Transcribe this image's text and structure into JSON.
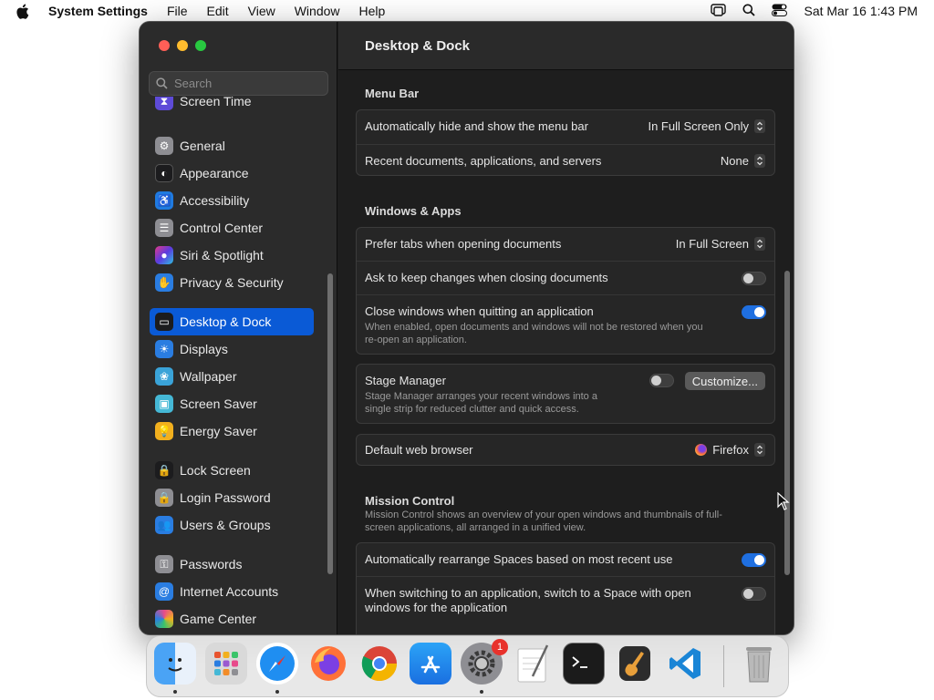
{
  "menubar": {
    "app_name": "System Settings",
    "menus": [
      "File",
      "Edit",
      "View",
      "Window",
      "Help"
    ],
    "datetime": "Sat Mar 16  1:43 PM"
  },
  "window": {
    "title": "Desktop & Dock"
  },
  "sidebar": {
    "search_placeholder": "Search",
    "items": [
      {
        "label": "Screen Time",
        "icon": "hourglass-icon",
        "color": "#5e4bd8"
      },
      {
        "label": "General",
        "icon": "gear-icon",
        "color": "#8e8e93"
      },
      {
        "label": "Appearance",
        "icon": "appearance-icon",
        "color": "#1c1c1e"
      },
      {
        "label": "Accessibility",
        "icon": "accessibility-icon",
        "color": "#1f7ae0"
      },
      {
        "label": "Control Center",
        "icon": "control-center-icon",
        "color": "#8e8e93"
      },
      {
        "label": "Siri & Spotlight",
        "icon": "siri-icon",
        "color": "#c63cc0"
      },
      {
        "label": "Privacy & Security",
        "icon": "hand-icon",
        "color": "#2a7de1"
      },
      {
        "label": "Desktop & Dock",
        "icon": "dock-icon",
        "color": "#1c1c1e"
      },
      {
        "label": "Displays",
        "icon": "sun-icon",
        "color": "#2a7de1"
      },
      {
        "label": "Wallpaper",
        "icon": "flower-icon",
        "color": "#3aa3d8"
      },
      {
        "label": "Screen Saver",
        "icon": "screen-saver-icon",
        "color": "#45b8d6"
      },
      {
        "label": "Energy Saver",
        "icon": "bulb-icon",
        "color": "#f2b01e"
      },
      {
        "label": "Lock Screen",
        "icon": "lock-icon",
        "color": "#1c1c1e"
      },
      {
        "label": "Login Password",
        "icon": "lock-icon",
        "color": "#8e8e93"
      },
      {
        "label": "Users & Groups",
        "icon": "users-icon",
        "color": "#2a7de1"
      },
      {
        "label": "Passwords",
        "icon": "key-icon",
        "color": "#8e8e93"
      },
      {
        "label": "Internet Accounts",
        "icon": "at-icon",
        "color": "#2a7de1"
      },
      {
        "label": "Game Center",
        "icon": "game-center-icon",
        "color": "#e8e8e8"
      }
    ]
  },
  "content": {
    "menu_bar": {
      "title": "Menu Bar",
      "auto_hide_label": "Automatically hide and show the menu bar",
      "auto_hide_value": "In Full Screen Only",
      "recent_label": "Recent documents, applications, and servers",
      "recent_value": "None"
    },
    "windows_apps": {
      "title": "Windows & Apps",
      "prefer_tabs_label": "Prefer tabs when opening documents",
      "prefer_tabs_value": "In Full Screen",
      "ask_keep_label": "Ask to keep changes when closing documents",
      "ask_keep_on": false,
      "close_windows_label": "Close windows when quitting an application",
      "close_windows_desc_1": "When enabled, open documents and windows will not be restored when you",
      "close_windows_desc_2": "re-open an application.",
      "close_windows_on": true
    },
    "stage_manager": {
      "label": "Stage Manager",
      "desc_1": "Stage Manager arranges your recent windows into a",
      "desc_2": "single strip for reduced clutter and quick access.",
      "on": false,
      "customize_label": "Customize..."
    },
    "browser": {
      "label": "Default web browser",
      "value": "Firefox"
    },
    "mission_control": {
      "title": "Mission Control",
      "desc_1": "Mission Control shows an overview of your open windows and thumbnails of full-",
      "desc_2": "screen applications, all arranged in a unified view.",
      "rearrange_label": "Automatically rearrange Spaces based on most recent use",
      "rearrange_on": true,
      "switch_label_1": "When switching to an application, switch to a Space with open",
      "switch_label_2": "windows for the application",
      "switch_on": false
    }
  },
  "dock": {
    "apps": [
      {
        "name": "finder-icon",
        "running": true
      },
      {
        "name": "launchpad-icon",
        "running": false
      },
      {
        "name": "safari-icon",
        "running": true
      },
      {
        "name": "firefox-icon",
        "running": false
      },
      {
        "name": "chrome-icon",
        "running": false
      },
      {
        "name": "app-store-icon",
        "running": false
      },
      {
        "name": "system-settings-icon",
        "running": true,
        "badge": "1"
      },
      {
        "name": "textedit-icon",
        "running": false
      },
      {
        "name": "terminal-icon",
        "running": false
      },
      {
        "name": "garageband-icon",
        "running": false
      },
      {
        "name": "vscode-icon",
        "running": false
      },
      {
        "name": "trash-icon",
        "running": false
      }
    ]
  }
}
